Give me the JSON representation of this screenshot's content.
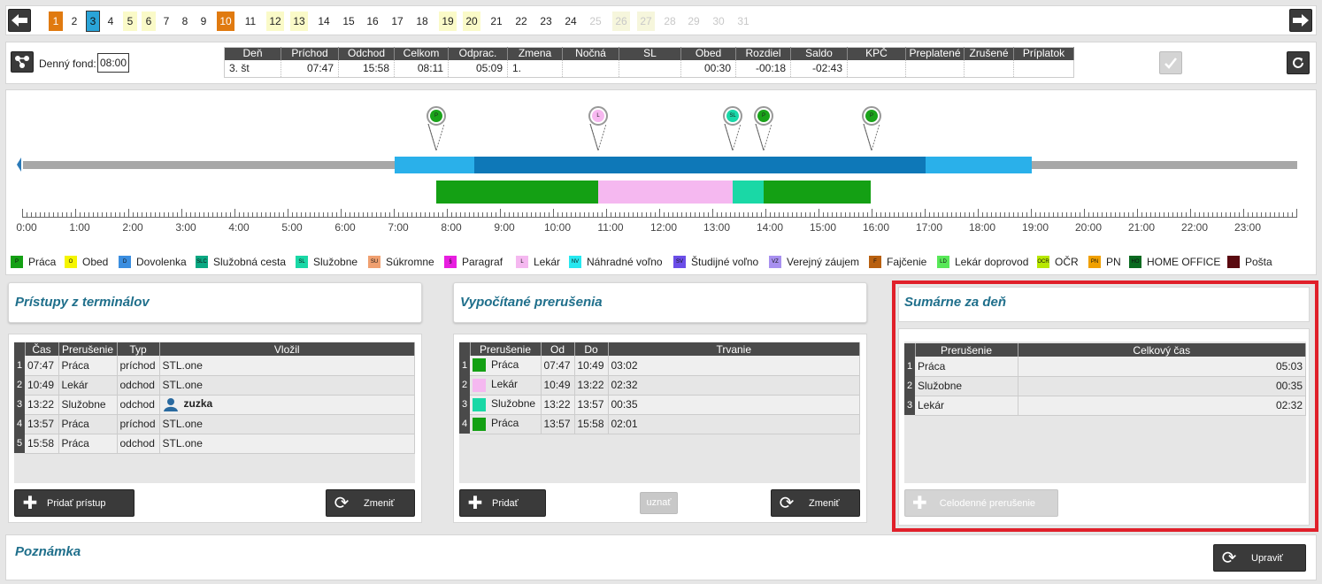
{
  "nav": {
    "prev_icon": "arrow-left-icon",
    "next_icon": "arrow-right-icon"
  },
  "days": [
    "1",
    "2",
    "3",
    "4",
    "5",
    "6",
    "7",
    "8",
    "9",
    "10",
    "11",
    "12",
    "13",
    "14",
    "15",
    "16",
    "17",
    "18",
    "19",
    "20",
    "21",
    "22",
    "23",
    "24",
    "25",
    "26",
    "27",
    "28",
    "29",
    "30",
    "31"
  ],
  "summary": {
    "fund_label": "Denný fond:",
    "fund_value": "08:00",
    "headers": [
      "Deň",
      "Príchod",
      "Odchod",
      "Celkom",
      "Odprac.",
      "Zmena",
      "Nočná",
      "SL",
      "Obed",
      "Rozdiel",
      "Saldo",
      "KPČ",
      "Preplatené",
      "Zrušené",
      "Príplatok"
    ],
    "row": [
      "3. št",
      "07:47",
      "15:58",
      "08:11",
      "05:09",
      "1.",
      "",
      "",
      "00:30",
      "-00:18",
      "-02:43",
      "",
      "",
      "",
      ""
    ]
  },
  "timeline": {
    "hours": [
      "0:00",
      "1:00",
      "2:00",
      "3:00",
      "4:00",
      "5:00",
      "6:00",
      "7:00",
      "8:00",
      "9:00",
      "10:00",
      "11:00",
      "12:00",
      "13:00",
      "14:00",
      "15:00",
      "16:00",
      "17:00",
      "18:00",
      "19:00",
      "20:00",
      "21:00",
      "22:00",
      "23:00"
    ],
    "pins": [
      {
        "code": "P",
        "color": "#1aa31a"
      },
      {
        "code": "L",
        "color": "#f7b8f0"
      },
      {
        "code": "SL",
        "color": "#19d8a8"
      },
      {
        "code": "P",
        "color": "#1aa31a"
      },
      {
        "code": "P",
        "color": "#1aa31a"
      }
    ]
  },
  "legend": [
    {
      "code": "P",
      "label": "Práca",
      "color": "#14a014"
    },
    {
      "code": "O",
      "label": "Obed",
      "color": "#f5f500"
    },
    {
      "code": "D",
      "label": "Dovolenka",
      "color": "#3b8ee0"
    },
    {
      "code": "SLC",
      "label": "Služobná cesta",
      "color": "#0aa882"
    },
    {
      "code": "SL",
      "label": "Služobne",
      "color": "#1ad8a6"
    },
    {
      "code": "SU",
      "label": "Súkromne",
      "color": "#f0a070"
    },
    {
      "code": "§",
      "label": "Paragraf",
      "color": "#e81ee0"
    },
    {
      "code": "L",
      "label": "Lekár",
      "color": "#f5b8f0"
    },
    {
      "code": "NV",
      "label": "Náhradné voľno",
      "color": "#26e8f0"
    },
    {
      "code": "SV",
      "label": "Študijné voľno",
      "color": "#6b4ee8"
    },
    {
      "code": "VZ",
      "label": "Verejný záujem",
      "color": "#a890f0"
    },
    {
      "code": "F",
      "label": "Fajčenie",
      "color": "#b86010"
    },
    {
      "code": "LD",
      "label": "Lekár doprovod",
      "color": "#58e858"
    },
    {
      "code": "OCR",
      "label": "OČR",
      "color": "#b8e800"
    },
    {
      "code": "PN",
      "label": "PN",
      "color": "#f0a000"
    },
    {
      "code": "HO",
      "label": "HOME OFFICE",
      "color": "#0a6a20"
    },
    {
      "code": "",
      "label": "Pošta",
      "color": "#5a0a10"
    }
  ],
  "access": {
    "title": "Prístupy z terminálov",
    "headers": [
      "Čas",
      "Prerušenie",
      "Typ",
      "Vložil"
    ],
    "rows": [
      {
        "n": "1",
        "time": "07:47",
        "type": "Práca",
        "dir": "príchod",
        "by": "STL.one"
      },
      {
        "n": "2",
        "time": "10:49",
        "type": "Lekár",
        "dir": "odchod",
        "by": "STL.one"
      },
      {
        "n": "3",
        "time": "13:22",
        "type": "Služobne",
        "dir": "odchod",
        "by": "zuzka"
      },
      {
        "n": "4",
        "time": "13:57",
        "type": "Práca",
        "dir": "príchod",
        "by": "STL.one"
      },
      {
        "n": "5",
        "time": "15:58",
        "type": "Práca",
        "dir": "odchod",
        "by": "STL.one"
      }
    ],
    "add_label": "Pridať prístup",
    "change_label": "Zmeniť"
  },
  "breaks": {
    "title": "Vypočítané prerušenia",
    "headers": [
      "Prerušenie",
      "Od",
      "Do",
      "Trvanie"
    ],
    "rows": [
      {
        "n": "1",
        "type": "Práca",
        "color": "#14a014",
        "from": "07:47",
        "to": "10:49",
        "dur": "03:02"
      },
      {
        "n": "2",
        "type": "Lekár",
        "color": "#f5b8f0",
        "from": "10:49",
        "to": "13:22",
        "dur": "02:32"
      },
      {
        "n": "3",
        "type": "Služobne",
        "color": "#1ad8a6",
        "from": "13:22",
        "to": "13:57",
        "dur": "00:35"
      },
      {
        "n": "4",
        "type": "Práca",
        "color": "#14a014",
        "from": "13:57",
        "to": "15:58",
        "dur": "02:01"
      }
    ],
    "add_label": "Pridať",
    "approve_label": "uznať",
    "change_label": "Zmeniť"
  },
  "daily": {
    "title": "Sumárne za deň",
    "headers": [
      "Prerušenie",
      "Celkový čas"
    ],
    "rows": [
      {
        "n": "1",
        "type": "Práca",
        "total": "05:03"
      },
      {
        "n": "2",
        "type": "Služobne",
        "total": "00:35"
      },
      {
        "n": "3",
        "type": "Lekár",
        "total": "02:32"
      }
    ],
    "full_day_label": "Celodenné prerušenie"
  },
  "note": {
    "title": "Poznámka",
    "edit_label": "Upraviť"
  },
  "colors": {
    "highlight": "#e0202a",
    "title": "#1f6f8b"
  }
}
